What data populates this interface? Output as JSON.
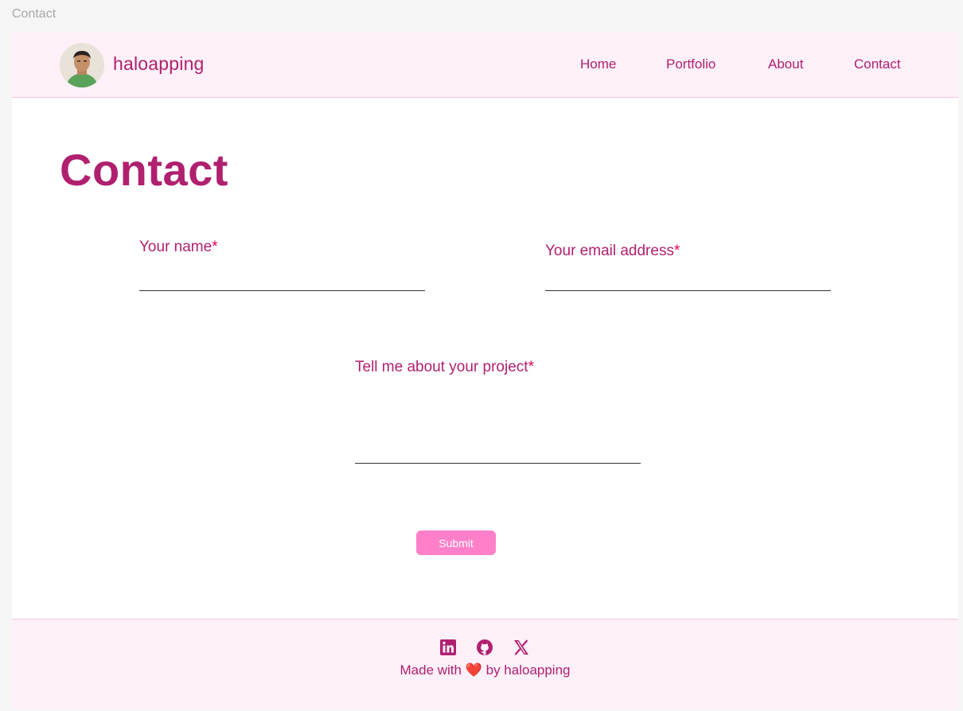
{
  "window": {
    "title": "Contact"
  },
  "header": {
    "brand": "haloapping",
    "nav": [
      "Home",
      "Portfolio",
      "About",
      "Contact"
    ]
  },
  "main": {
    "title": "Contact",
    "form": {
      "name_label": "Your name",
      "email_label": "Your email address",
      "project_label": "Tell me about your project",
      "required_mark": "*",
      "submit_label": "Submit"
    }
  },
  "footer": {
    "made_prefix": "Made with",
    "heart": "❤️",
    "made_suffix": "by haloapping",
    "social_icons": [
      "linkedin-icon",
      "github-icon",
      "x-icon"
    ]
  },
  "colors": {
    "brand": "#b0206f",
    "header_bg": "#fdf0f8",
    "button": "#ff80c8",
    "required": "#e5005a"
  }
}
